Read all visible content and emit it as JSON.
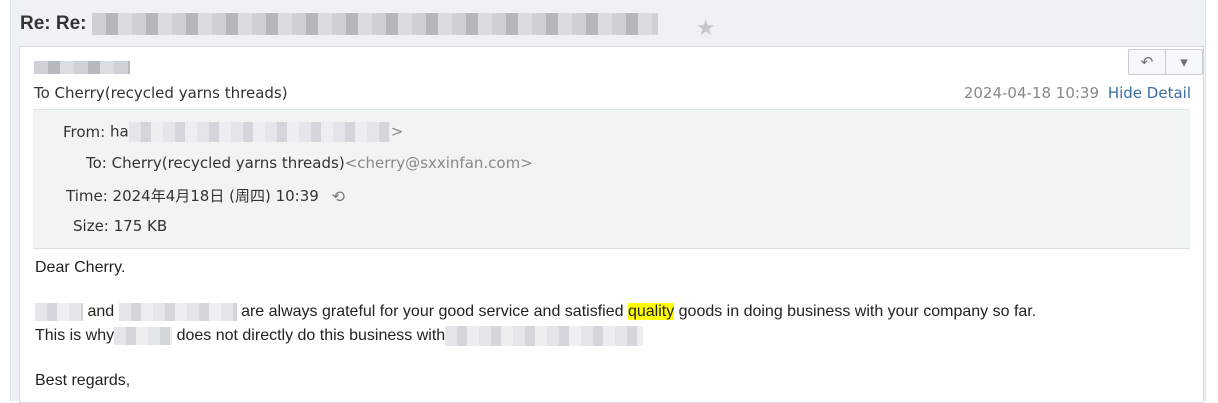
{
  "subject": {
    "prefix": "Re: Re: "
  },
  "header": {
    "to_summary": "To Cherry(recycled yarns threads)",
    "date": "2024-04-18 10:39",
    "hide_detail": "Hide Detail"
  },
  "details": {
    "from_label": "From:",
    "from_value_start": "ha",
    "from_value_end": ">",
    "to_label": "To:",
    "to_name": "Cherry(recycled yarns threads)",
    "to_email": "<cherry@sxxinfan.com>",
    "time_label": "Time:",
    "time_value": "2024年4月18日 (周四) 10:39",
    "size_label": "Size:",
    "size_value": "175 KB"
  },
  "body": {
    "greeting": "Dear Cherry.",
    "line1_and": "and",
    "line1_text": "are always grateful for your good service and satisfied",
    "line1_highlight": "quality",
    "line1_tail": "goods in doing business with your company so far.",
    "line2_start": "This is why",
    "line2_mid": "does not directly do this business with",
    "closing": "Best regards,"
  },
  "icons": {
    "star": "star-icon",
    "reply": "reply-icon",
    "more": "chevron-down-icon",
    "history": "history-icon"
  },
  "colors": {
    "link": "#3a6ea5",
    "highlight": "#ffff00",
    "detail_bg": "#f0f4f2"
  }
}
